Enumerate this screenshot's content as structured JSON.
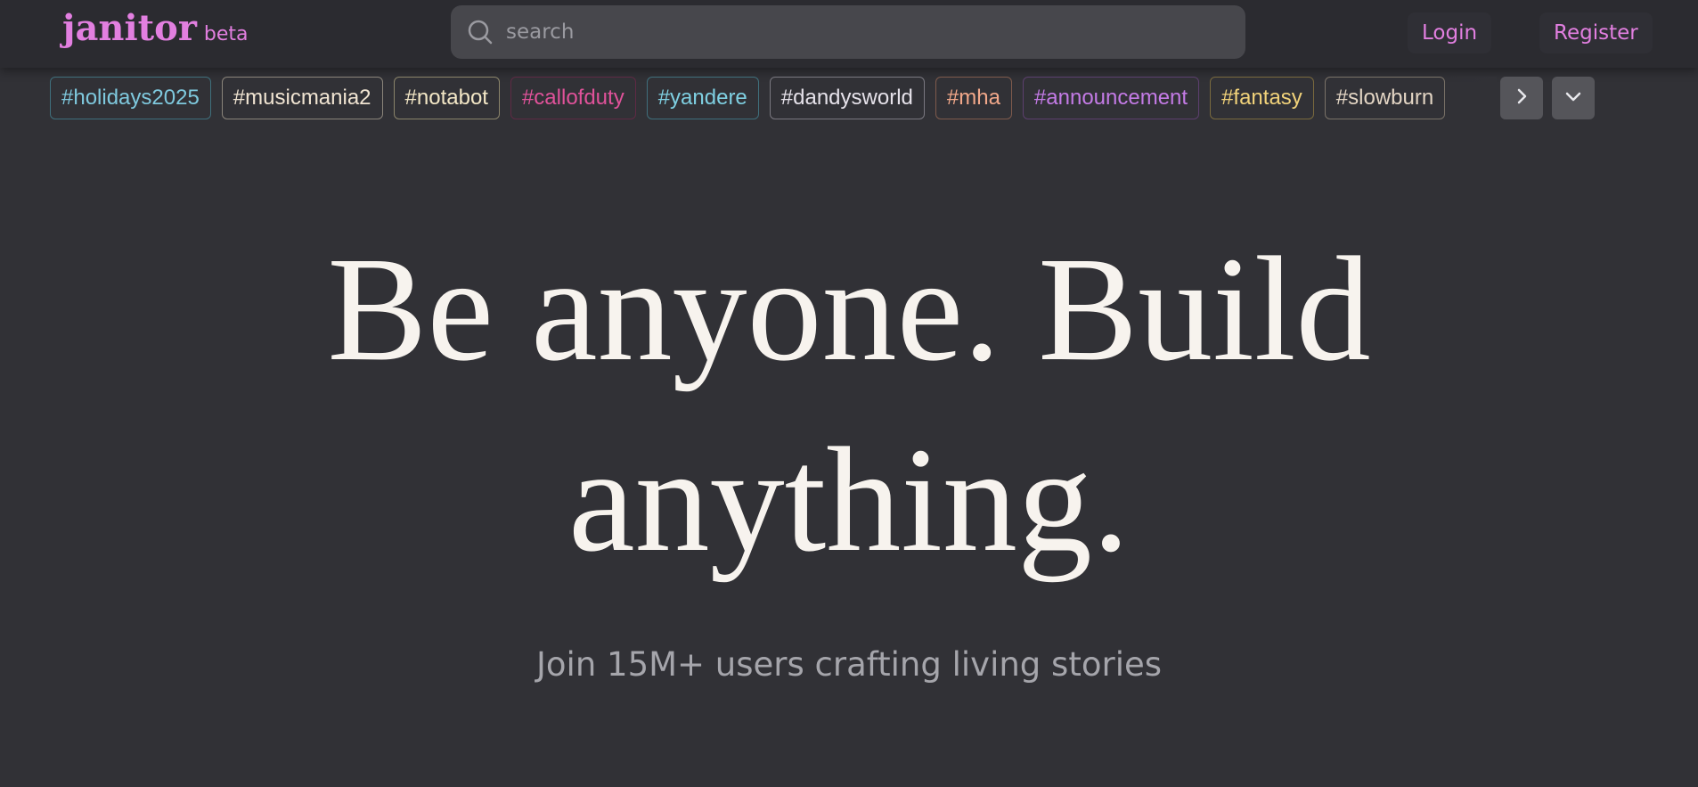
{
  "header": {
    "logo": "janitor",
    "logo_tag": "beta",
    "search_placeholder": "search",
    "login_label": "Login",
    "register_label": "Register",
    "accent_color": "#e27fe0"
  },
  "tags": [
    {
      "label": "#holidays2025",
      "color": "#7fc9de",
      "border": "#3f6f7c"
    },
    {
      "label": "#musicmania2",
      "color": "#f0e4d2",
      "border": "#8a847a"
    },
    {
      "label": "#notabot",
      "color": "#f3e7c6",
      "border": "#8a846a"
    },
    {
      "label": "#callofduty",
      "color": "#e0529a",
      "border": "#5e2a44"
    },
    {
      "label": "#yandere",
      "color": "#7fd0e2",
      "border": "#3f6f7c"
    },
    {
      "label": "#dandysworld",
      "color": "#e6e2ea",
      "border": "#7a7880"
    },
    {
      "label": "#mha",
      "color": "#f2a88a",
      "border": "#7e5a4c"
    },
    {
      "label": "#announcement",
      "color": "#c47be6",
      "border": "#5c3f6e"
    },
    {
      "label": "#fantasy",
      "color": "#f1d27a",
      "border": "#7a6a3e"
    },
    {
      "label": "#slowburn",
      "color": "#e3d5c4",
      "border": "#7a7268"
    }
  ],
  "tag_controls": {
    "next_icon": "chevron-right-icon",
    "expand_icon": "chevron-down-icon"
  },
  "hero": {
    "line1": "Be anyone. Build",
    "line2": "anything.",
    "subtitle": "Join 15M+ users crafting living stories"
  }
}
